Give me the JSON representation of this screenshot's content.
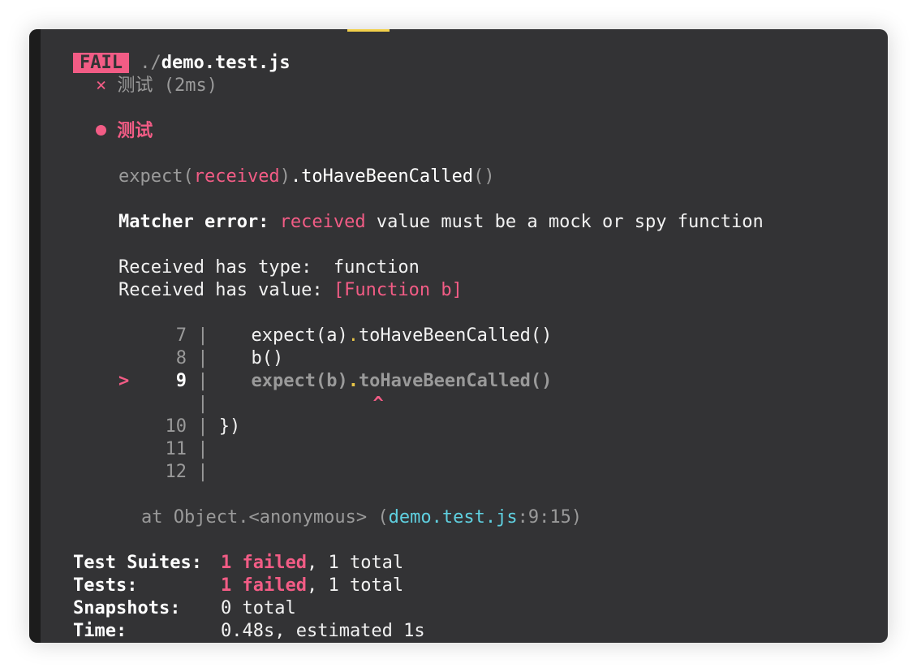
{
  "header": {
    "status_badge": "FAIL",
    "path_prefix": "./",
    "file_name": "demo.test.js",
    "test_icon": "×",
    "test_name": "测试",
    "test_duration": "(2ms)"
  },
  "error": {
    "bullet_title": "测试",
    "expect_prefix": "expect(",
    "expect_received": "received",
    "expect_suffix": ").toHaveBeenCalled",
    "expect_parens": "()",
    "matcher_label": "Matcher error:",
    "matcher_received": "received",
    "matcher_message": " value must be a mock or spy function",
    "type_label": "Received has type:  ",
    "type_value": "function",
    "value_label": "Received has value: ",
    "value_value": "[Function b]"
  },
  "code_frame": {
    "lines": [
      {
        "marker": "",
        "num": "7",
        "sep": "|",
        "code_a": "    expect(a)",
        "dot": ".",
        "code_b": "toHaveBeenCalled()"
      },
      {
        "marker": "",
        "num": "8",
        "sep": "|",
        "code_a": "    b()",
        "dot": "",
        "code_b": ""
      },
      {
        "marker": ">",
        "num": "9",
        "sep": "|",
        "code_a": "    expect(b)",
        "dot": ".",
        "code_b": "toHaveBeenCalled()"
      },
      {
        "marker": "",
        "num": "",
        "sep": "|",
        "code_a": "",
        "dot": "",
        "code_b": ""
      },
      {
        "marker": "",
        "num": "10",
        "sep": "|",
        "code_a": " })",
        "dot": "",
        "code_b": ""
      },
      {
        "marker": "",
        "num": "11",
        "sep": "|",
        "code_a": "",
        "dot": "",
        "code_b": ""
      },
      {
        "marker": "",
        "num": "12",
        "sep": "|",
        "code_a": "",
        "dot": "",
        "code_b": ""
      }
    ],
    "caret": "^"
  },
  "stack": {
    "at_text": "at Object.<anonymous> (",
    "file": "demo.test.js",
    "location": ":9:15)"
  },
  "summary": [
    {
      "label": "Test Suites:",
      "failed": "1 failed",
      "rest": ", 1 total"
    },
    {
      "label": "Tests:",
      "failed": "1 failed",
      "rest": ", 1 total"
    },
    {
      "label": "Snapshots:",
      "failed": "",
      "rest": "0 total"
    },
    {
      "label": "Time:",
      "failed": "",
      "rest": "0.48s, estimated 1s"
    }
  ],
  "colors": {
    "background": "#333335",
    "fail": "#f25c85",
    "link": "#5fd0e0",
    "highlight": "#e8c547"
  }
}
